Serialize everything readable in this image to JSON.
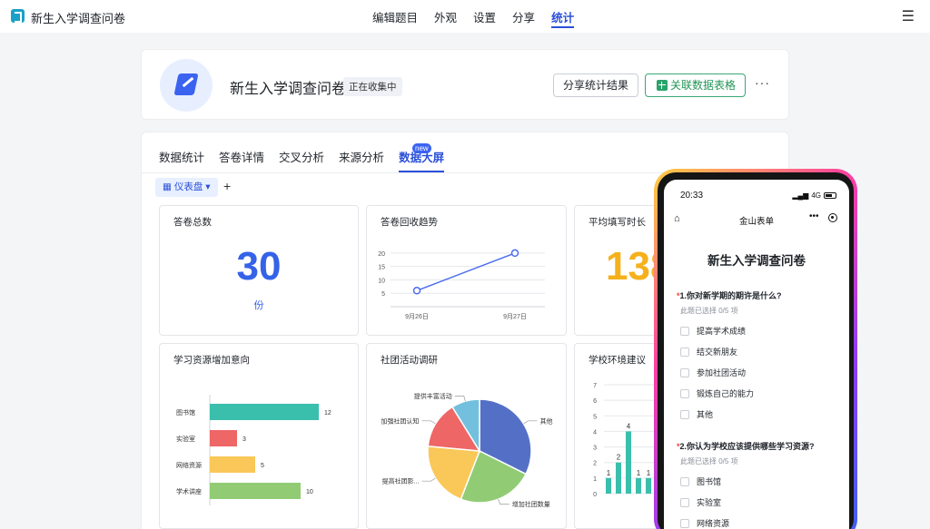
{
  "app": {
    "title": "新生入学调查问卷",
    "icon": "form-logo-icon"
  },
  "nav": [
    {
      "label": "编辑题目"
    },
    {
      "label": "外观"
    },
    {
      "label": "设置"
    },
    {
      "label": "分享"
    },
    {
      "label": "统计",
      "active": true
    }
  ],
  "header": {
    "form_name": "新生入学调查问卷",
    "status": "正在收集中",
    "share_button": "分享统计结果",
    "link_button": "关联数据表格",
    "more": "···"
  },
  "tabs": [
    {
      "label": "数据统计"
    },
    {
      "label": "答卷详情"
    },
    {
      "label": "交叉分析"
    },
    {
      "label": "来源分析"
    },
    {
      "label": "数据大屏",
      "active": true,
      "badge": "new"
    }
  ],
  "dashboard": {
    "selector_label": "仪表盘",
    "add_label": "+"
  },
  "widgets": {
    "total": {
      "title": "答卷总数",
      "value": "30",
      "unit": "份"
    },
    "trend": {
      "title": "答卷回收趋势"
    },
    "avg_time": {
      "title": "平均填写时长",
      "value": "138"
    },
    "resources": {
      "title": "学习资源增加意向"
    },
    "clubs": {
      "title": "社团活动调研"
    },
    "environment": {
      "title": "学校环境建议"
    }
  },
  "chart_data": [
    {
      "type": "line",
      "title": "答卷回收趋势",
      "categories": [
        "9月26日",
        "9月27日"
      ],
      "series": [
        {
          "values": [
            6,
            20
          ]
        }
      ],
      "yticks": [
        5,
        10,
        15,
        20
      ],
      "color": "#4a6cf0"
    },
    {
      "type": "bar",
      "orientation": "horizontal",
      "title": "学习资源增加意向",
      "categories": [
        "图书馆",
        "实验室",
        "网络资源",
        "学术讲座"
      ],
      "values": [
        12,
        3,
        5,
        10
      ],
      "colors": [
        "#3bbfad",
        "#ee6666",
        "#fac858",
        "#91cc75"
      ]
    },
    {
      "type": "pie",
      "title": "社团活动调研",
      "categories": [
        "其他",
        "增加社团数量",
        "提高社团影...",
        "加强社团认知",
        "提供丰富活动"
      ],
      "values": [
        11,
        8,
        7,
        5,
        3
      ],
      "colors": [
        "#5470c6",
        "#91cc75",
        "#fac858",
        "#ee6666",
        "#73c0de"
      ]
    },
    {
      "type": "bar",
      "title": "学校环境建议",
      "yticks": [
        0,
        1,
        2,
        3,
        4,
        5,
        6,
        7
      ],
      "values": [
        1,
        2,
        4,
        1,
        1
      ],
      "color": "#3bbfad"
    }
  ],
  "phone": {
    "time": "20:33",
    "signal": "4G",
    "app_title": "金山表单",
    "form_title": "新生入学调查问卷",
    "q1": {
      "req": "*",
      "text": "1.你对新学期的期许是什么?",
      "hint": "此题已选择 0/5 项",
      "options": [
        "提高学术成绩",
        "结交新朋友",
        "参加社团活动",
        "锻炼自己的能力",
        "其他"
      ]
    },
    "q2": {
      "req": "*",
      "text": "2.你认为学校应该提供哪些学习资源?",
      "hint": "此题已选择 0/5 项",
      "options": [
        "图书馆",
        "实验室",
        "网络资源"
      ]
    }
  }
}
